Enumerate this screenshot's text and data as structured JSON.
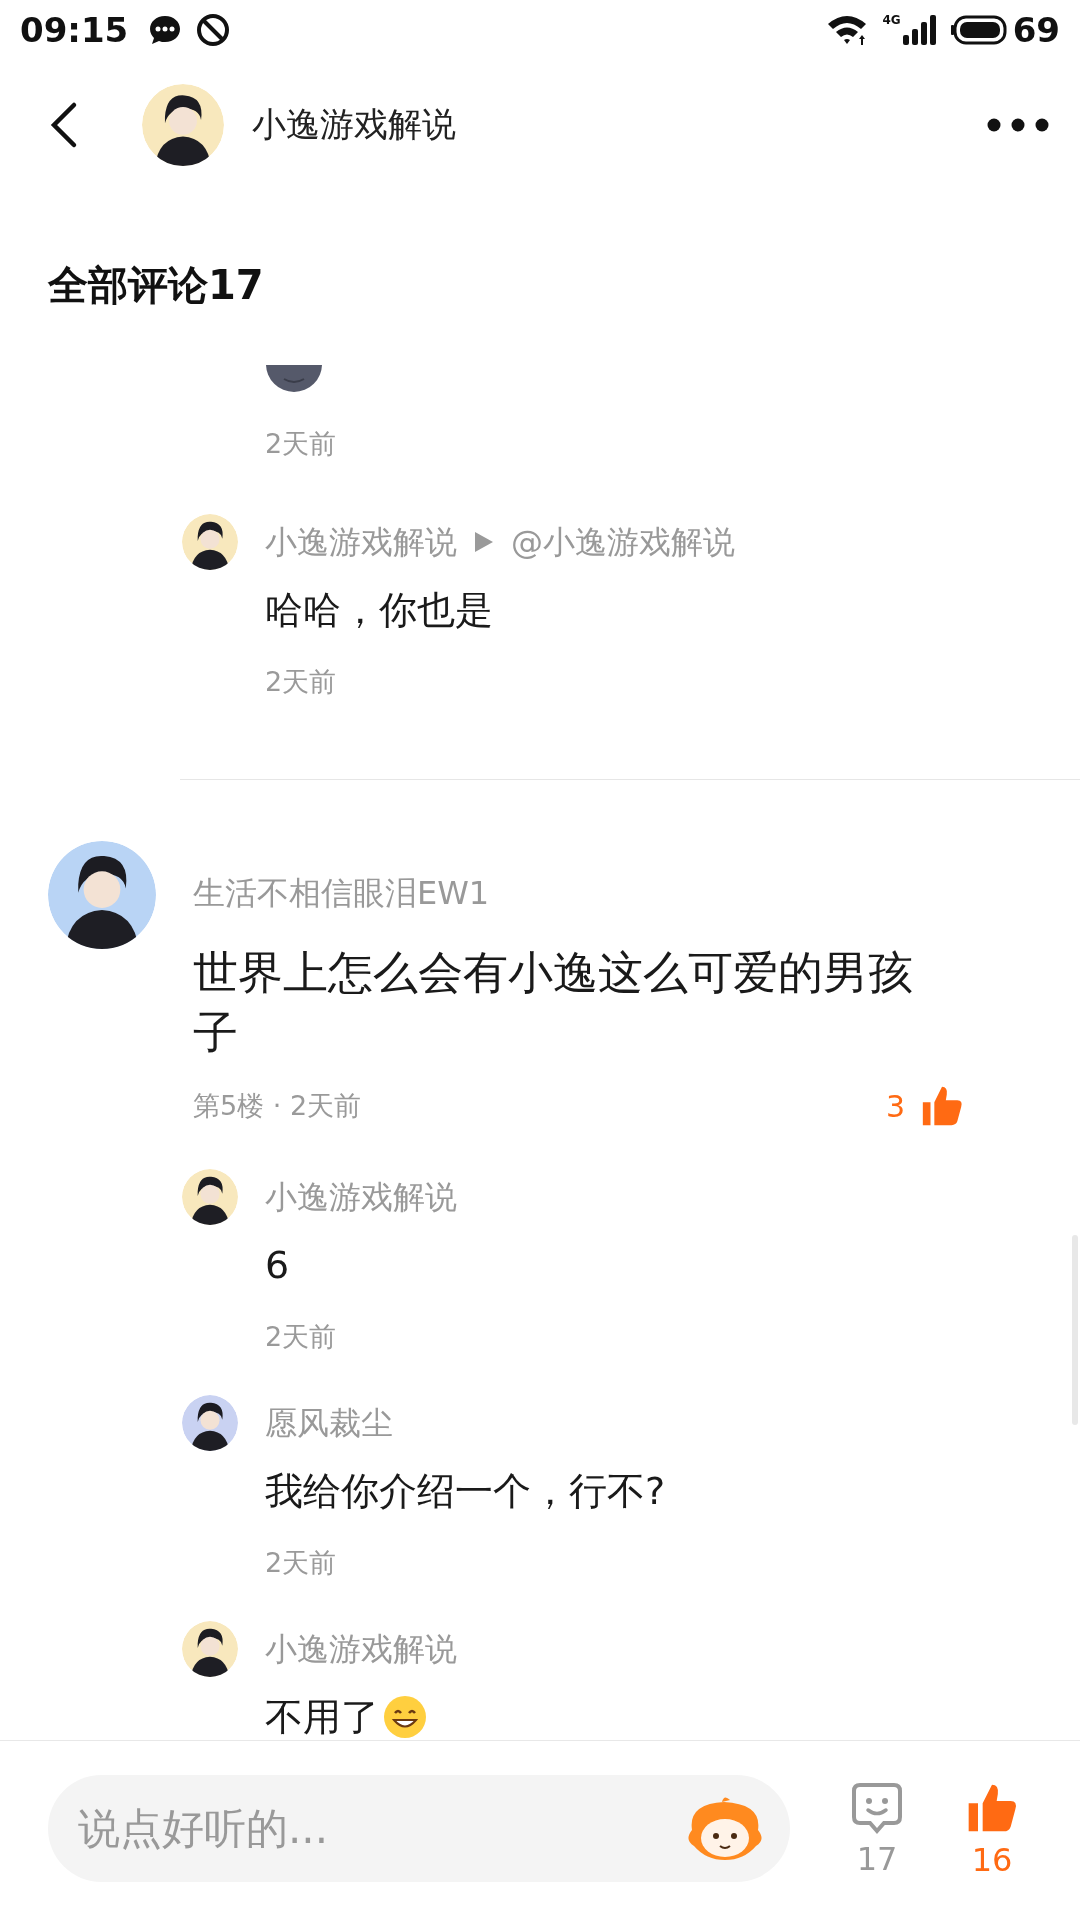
{
  "status_bar": {
    "time": "09:15",
    "network": "4G",
    "battery": "69"
  },
  "header": {
    "title": "小逸游戏解说"
  },
  "section_title": "全部评论17",
  "threads": [
    {
      "replies": [
        {
          "kind": "emoji",
          "time": "2天前"
        },
        {
          "kind": "text",
          "author": "小逸游戏解说",
          "reply_to": "@小逸游戏解说",
          "text": "哈哈，你也是",
          "time": "2天前"
        }
      ]
    },
    {
      "author": "生活不相信眼泪EW1",
      "text": "世界上怎么会有小逸这么可爱的男孩子",
      "meta": "第5楼 · 2天前",
      "likes": "3",
      "liked": true,
      "replies": [
        {
          "kind": "text",
          "author": "小逸游戏解说",
          "text": "6",
          "time": "2天前"
        },
        {
          "kind": "text",
          "author": "愿风裁尘",
          "text": "我给你介绍一个，行不?",
          "time": "2天前"
        },
        {
          "kind": "text",
          "author": "小逸游戏解说",
          "text": "不用了",
          "emoji": true
        }
      ]
    }
  ],
  "bottom_bar": {
    "placeholder": "说点好听的...",
    "comments": "17",
    "likes": "16",
    "liked": true
  }
}
